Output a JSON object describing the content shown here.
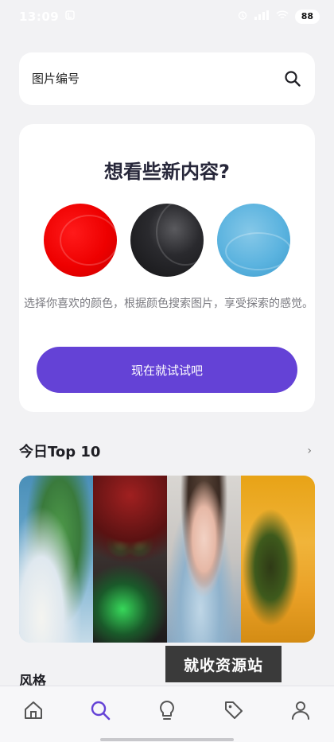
{
  "status_bar": {
    "time": "13:09",
    "battery": "88"
  },
  "search": {
    "placeholder": "图片编号",
    "icon": "search-icon"
  },
  "color_card": {
    "title": "想看些新内容?",
    "swatches": [
      {
        "name": "red",
        "color": "#ee0000"
      },
      {
        "name": "black",
        "color": "#1f1f22"
      },
      {
        "name": "blue",
        "color": "#5bb3df"
      }
    ],
    "description": "选择你喜欢的颜色，根据颜色搜索图片，享受探索的感觉。",
    "button_label": "现在就试试吧",
    "button_color": "#6442d6"
  },
  "top10": {
    "title": "今日Top 10",
    "more": "›",
    "thumbnails": [
      "dragon",
      "orc",
      "girl",
      "grass"
    ]
  },
  "watermark": "就收资源站",
  "style_section": {
    "title": "风格"
  },
  "bottom_nav": {
    "items": [
      "home-icon",
      "search-icon",
      "lightbulb-icon",
      "tag-icon",
      "profile-icon"
    ],
    "active": "search-icon",
    "active_color": "#6442d6"
  }
}
